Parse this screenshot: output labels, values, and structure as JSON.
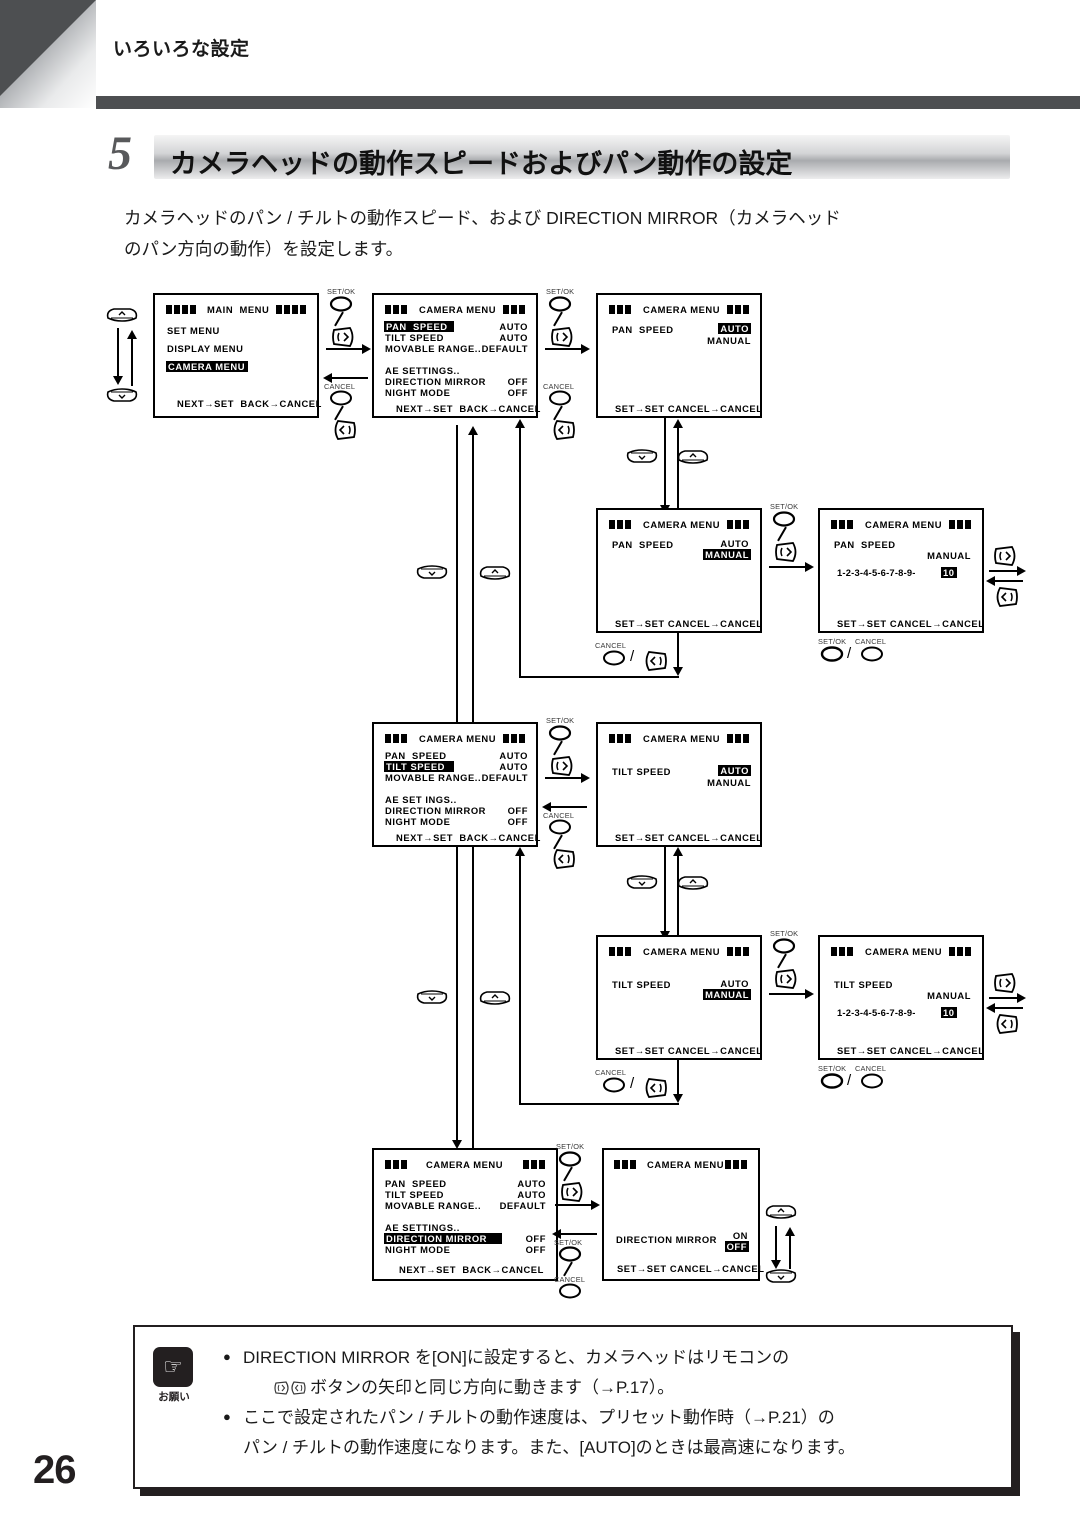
{
  "header": {
    "running_title": "いろいろな設定"
  },
  "section": {
    "number": "5",
    "title": "カメラヘッドの動作スピードおよびパン動作の設定",
    "intro_line1": "カメラヘッドのパン / チルトの動作スピード、および DIRECTION MIRROR（カメラヘッド",
    "intro_line2": "のパン方向の動作）を設定します。"
  },
  "page_number": "26",
  "buttons": {
    "set_ok": "SET/OK",
    "cancel": "CANCEL",
    "separator": "/"
  },
  "screens": {
    "main_menu": {
      "title": "MAIN  MENU",
      "items": [
        "SET MENU",
        "DISPLAY MENU",
        "CAMERA MENU"
      ],
      "selected": "CAMERA MENU",
      "footer": "NEXT→SET  BACK→CANCEL"
    },
    "camera_menu_pan": {
      "title": "CAMERA MENU",
      "rows": [
        {
          "label": "PAN  SPEED",
          "value": "AUTO",
          "selected": true
        },
        {
          "label": "TILT SPEED",
          "value": "AUTO",
          "selected": false
        },
        {
          "label": "MOVABLE RANGE..",
          "value": "DEFAULT",
          "selected": false
        }
      ],
      "rows2": [
        {
          "label": "AE SETTINGS..",
          "value": "",
          "selected": false
        },
        {
          "label": "DIRECTION MIRROR",
          "value": "OFF",
          "selected": false
        },
        {
          "label": "NIGHT MODE",
          "value": "OFF",
          "selected": false
        }
      ],
      "footer": "NEXT→SET  BACK→CANCEL"
    },
    "pan_speed_auto": {
      "title": "CAMERA MENU",
      "label": "PAN  SPEED",
      "options": [
        "AUTO",
        "MANUAL"
      ],
      "selected": "AUTO",
      "footer": "SET→SET CANCEL→CANCEL"
    },
    "pan_speed_manual": {
      "title": "CAMERA MENU",
      "label": "PAN  SPEED",
      "options": [
        "AUTO",
        "MANUAL"
      ],
      "selected": "MANUAL",
      "footer": "SET→SET CANCEL→CANCEL"
    },
    "pan_speed_level": {
      "title": "CAMERA MENU",
      "label": "PAN  SPEED",
      "mode": "MANUAL",
      "scale": "1-2-3-4-5-6-7-8-9-",
      "scale_selected": "10",
      "footer": "SET→SET CANCEL→CANCEL"
    },
    "camera_menu_tilt": {
      "title": "CAMERA MENU",
      "rows": [
        {
          "label": "PAN  SPEED",
          "value": "AUTO",
          "selected": false
        },
        {
          "label": "TILT SPEED",
          "value": "AUTO",
          "selected": true
        },
        {
          "label": "MOVABLE RANGE..",
          "value": "DEFAULT",
          "selected": false
        }
      ],
      "rows2": [
        {
          "label": "AE SET INGS..",
          "value": "",
          "selected": false
        },
        {
          "label": "DIRECTION MIRROR",
          "value": "OFF",
          "selected": false
        },
        {
          "label": "NIGHT MODE",
          "value": "OFF",
          "selected": false
        }
      ],
      "footer": "NEXT→SET  BACK→CANCEL"
    },
    "tilt_speed_auto": {
      "title": "CAMERA MENU",
      "label": "TILT SPEED",
      "options": [
        "AUTO",
        "MANUAL"
      ],
      "selected": "AUTO",
      "footer": "SET→SET CANCEL→CANCEL"
    },
    "tilt_speed_manual": {
      "title": "CAMERA MENU",
      "label": "TILT SPEED",
      "options": [
        "AUTO",
        "MANUAL"
      ],
      "selected": "MANUAL",
      "footer": "SET→SET CANCEL→CANCEL"
    },
    "tilt_speed_level": {
      "title": "CAMERA MENU",
      "label": "TILT SPEED",
      "mode": "MANUAL",
      "scale": "1-2-3-4-5-6-7-8-9-",
      "scale_selected": "10",
      "footer": "SET→SET CANCEL→CANCEL"
    },
    "camera_menu_mirror": {
      "title": "CAMERA MENU",
      "rows": [
        {
          "label": "PAN  SPEED",
          "value": "AUTO",
          "selected": false
        },
        {
          "label": "TILT SPEED",
          "value": "AUTO",
          "selected": false
        },
        {
          "label": "MOVABLE RANGE..",
          "value": "DEFAULT",
          "selected": false
        }
      ],
      "rows2": [
        {
          "label": "AE SETTINGS..",
          "value": "",
          "selected": false
        },
        {
          "label": "DIRECTION MIRROR",
          "value": "OFF",
          "selected": true
        },
        {
          "label": "NIGHT MODE",
          "value": "OFF",
          "selected": false
        }
      ],
      "footer": "NEXT→SET  BACK→CANCEL"
    },
    "direction_mirror": {
      "title": "CAMERA MENU",
      "label": "DIRECTION MIRROR",
      "options": [
        "ON",
        "OFF"
      ],
      "selected": "OFF",
      "footer": "SET→SET CANCEL→CANCEL"
    }
  },
  "note": {
    "icon_label": "お願い",
    "bullet": "●",
    "items": [
      {
        "line1": "DIRECTION MIRROR を[ON]に設定すると、カメラヘッドはリモコンの",
        "line2": "ボタンの矢印と同じ方向に動きます（→P.17）。"
      },
      {
        "line1": "ここで設定されたパン / チルトの動作速度は、プリセット動作時（→P.21）の",
        "line2": "パン / チルトの動作速度になります。また、[AUTO]のときは最高速になります。"
      }
    ]
  }
}
